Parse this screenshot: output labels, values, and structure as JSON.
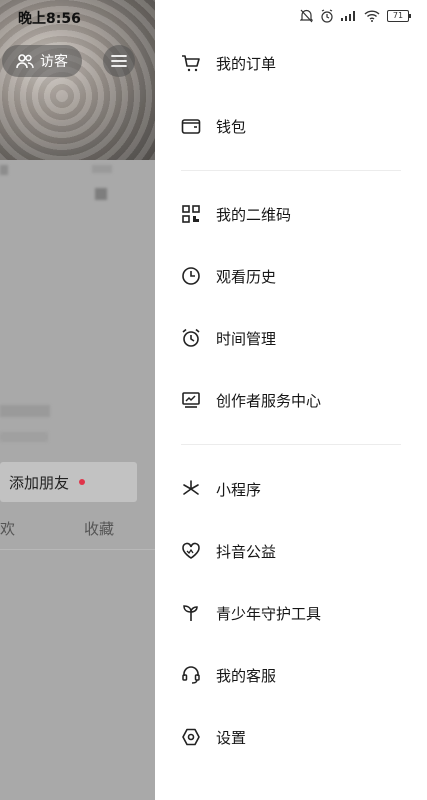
{
  "status_bar": {
    "time": "晚上8:56",
    "battery": "71"
  },
  "background_page": {
    "visitor_label": "访客",
    "add_friend_label": "添加朋友",
    "tabs": [
      "欢",
      "收藏"
    ]
  },
  "drawer": {
    "groups": [
      [
        {
          "label": "我的订单",
          "icon": "cart-icon"
        },
        {
          "label": "钱包",
          "icon": "wallet-icon"
        }
      ],
      [
        {
          "label": "我的二维码",
          "icon": "qrcode-icon"
        },
        {
          "label": "观看历史",
          "icon": "clock-icon"
        },
        {
          "label": "时间管理",
          "icon": "alarm-icon"
        },
        {
          "label": "创作者服务中心",
          "icon": "chart-monitor-icon"
        }
      ],
      [
        {
          "label": "小程序",
          "icon": "asterisk-icon"
        },
        {
          "label": "抖音公益",
          "icon": "heart-icon"
        },
        {
          "label": "青少年守护工具",
          "icon": "sprout-icon"
        },
        {
          "label": "我的客服",
          "icon": "headset-icon"
        },
        {
          "label": "设置",
          "icon": "hexagon-settings-icon"
        }
      ]
    ]
  }
}
